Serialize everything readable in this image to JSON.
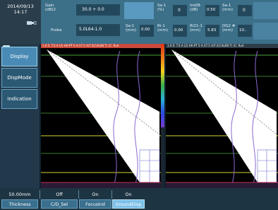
{
  "status": {
    "date": "2014/09/13",
    "time": "14:17",
    "gain_label": "Gain\n(dB)2",
    "gain_value": "30.0 + 0.0",
    "probe_label": "Probe",
    "probe_value": "5.0L64-1.0",
    "readouts": [
      {
        "label": "Sa-1\n(%)",
        "value": "0"
      },
      {
        "label": "Sa-1\n(mm)",
        "value": "0.00"
      },
      {
        "label": "Sa-1\n(%)",
        "value": "0"
      },
      {
        "label": "Ri-1\n(mm)",
        "value": "0.00"
      },
      {
        "label": "Ind(B-\n(dB)",
        "value": "0.50"
      },
      {
        "label": "Ri21-1\n(mm)",
        "value": "5.83"
      },
      {
        "label": "Sa-1\n(mm)",
        "value": "0"
      },
      {
        "label": "DG2 #\n(mm)",
        "value": "10.."
      }
    ]
  },
  "left_menu": {
    "items": [
      {
        "label": "Display",
        "active": true
      },
      {
        "label": "DispMode",
        "active": false
      },
      {
        "label": "Indication",
        "active": false
      }
    ]
  },
  "panels": {
    "left_header": "1.0 S: T.S A (2) HA-PT S A-37.5 A/T-2(CALEN T) (C: RuA",
    "right_header": "1.0 S: T.S A (2) HA-PT S A-37.5 A/T-2(CALEN T) (C: RuA"
  },
  "bottom_menu": {
    "values": [
      "50.00mm",
      "Off",
      "On",
      "On"
    ],
    "buttons": [
      {
        "label": "Thickness",
        "active": false
      },
      {
        "label": "C/D_Sel",
        "active": false
      },
      {
        "label": "FocusInd",
        "active": false
      },
      {
        "label": "GroundDisp",
        "active": true
      }
    ]
  },
  "colors": {
    "accent": "#7cc0e8",
    "topbar": "#3c6f88",
    "scan_background": "#000000",
    "green_gate": "#4ea43a",
    "yellow_gate": "#d8d83a",
    "purple_cursor": "#8a6ad0"
  },
  "icons": {
    "power_plug": "plug-icon",
    "wifi": "wifi-icon"
  }
}
